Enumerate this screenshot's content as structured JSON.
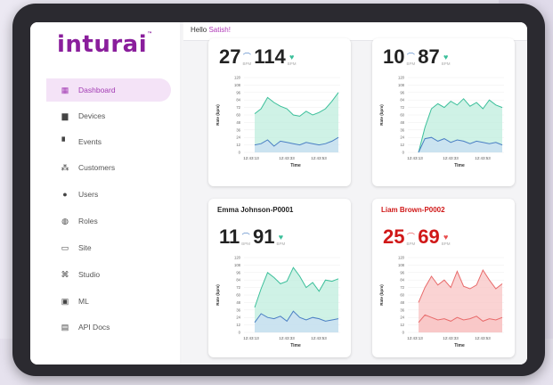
{
  "app": {
    "logo_text": "inturai",
    "greeting_prefix": "Hello",
    "user_name": "Satish!"
  },
  "sidebar": {
    "items": [
      {
        "label": "Dashboard",
        "icon": "grid-icon",
        "active": true
      },
      {
        "label": "Devices",
        "icon": "devices-icon",
        "active": false
      },
      {
        "label": "Events",
        "icon": "events-icon",
        "active": false
      },
      {
        "label": "Customers",
        "icon": "customers-icon",
        "active": false
      },
      {
        "label": "Users",
        "icon": "user-icon",
        "active": false
      },
      {
        "label": "Roles",
        "icon": "roles-icon",
        "active": false
      },
      {
        "label": "Site",
        "icon": "site-icon",
        "active": false
      },
      {
        "label": "Studio",
        "icon": "studio-icon",
        "active": false
      },
      {
        "label": "ML",
        "icon": "ml-icon",
        "active": false
      },
      {
        "label": "API Docs",
        "icon": "docs-icon",
        "active": false
      }
    ]
  },
  "colors": {
    "brand": "#8a1e9c",
    "active_bg": "#f4e3f7",
    "heart_fill": "#bfeedd",
    "heart_line": "#3bbf9a",
    "resp_fill": "#c9def3",
    "resp_line": "#4a7fc4",
    "alert_fill": "#f8c4c4",
    "alert_line": "#e86a6a"
  },
  "cards": [
    {
      "title": "",
      "alert": false,
      "resp_rate": "27",
      "heart_rate": "114",
      "unit": "BPM",
      "ylabel": "Rate (bpm)",
      "xlabel": "Time",
      "y_ticks": [
        "120",
        "108",
        "96",
        "84",
        "72",
        "60",
        "48",
        "36",
        "24",
        "12",
        "0"
      ],
      "x_ticks": [
        "12:43:13",
        "12:43:33",
        "12:43:53"
      ],
      "heart_series": [
        62,
        70,
        88,
        80,
        74,
        70,
        60,
        58,
        66,
        60,
        64,
        70,
        82,
        96
      ],
      "resp_series": [
        12,
        14,
        20,
        10,
        18,
        16,
        14,
        12,
        16,
        14,
        12,
        14,
        18,
        24
      ]
    },
    {
      "title": "",
      "alert": false,
      "resp_rate": "10",
      "heart_rate": "87",
      "unit": "BPM",
      "ylabel": "Rate (bpm)",
      "xlabel": "Time",
      "y_ticks": [
        "120",
        "108",
        "96",
        "84",
        "72",
        "60",
        "48",
        "36",
        "24",
        "12",
        "0"
      ],
      "x_ticks": [
        "12:43:13",
        "12:43:33",
        "12:43:53"
      ],
      "heart_series": [
        0,
        40,
        70,
        78,
        72,
        82,
        76,
        86,
        74,
        80,
        70,
        84,
        76,
        72
      ],
      "resp_series": [
        0,
        22,
        24,
        18,
        22,
        16,
        20,
        18,
        14,
        18,
        16,
        14,
        16,
        12
      ]
    },
    {
      "title": "Emma Johnson-P0001",
      "alert": false,
      "resp_rate": "11",
      "heart_rate": "91",
      "unit": "BPM",
      "ylabel": "Rate (bpm)",
      "xlabel": "Time",
      "y_ticks": [
        "120",
        "108",
        "96",
        "84",
        "72",
        "60",
        "48",
        "36",
        "24",
        "12",
        "0"
      ],
      "x_ticks": [
        "12:43:13",
        "12:43:33",
        "12:43:53"
      ],
      "heart_series": [
        40,
        70,
        96,
        88,
        78,
        82,
        104,
        90,
        72,
        80,
        66,
        84,
        82,
        86
      ],
      "resp_series": [
        16,
        30,
        24,
        22,
        26,
        18,
        34,
        24,
        20,
        24,
        22,
        18,
        20,
        22
      ]
    },
    {
      "title": "Liam Brown-P0002",
      "alert": true,
      "resp_rate": "25",
      "heart_rate": "69",
      "unit": "BPM",
      "ylabel": "Rate (bpm)",
      "xlabel": "Time",
      "y_ticks": [
        "120",
        "108",
        "96",
        "84",
        "72",
        "60",
        "48",
        "36",
        "24",
        "12",
        "0"
      ],
      "x_ticks": [
        "12:43:13",
        "12:43:33",
        "12:43:53"
      ],
      "heart_series": [
        48,
        72,
        90,
        76,
        84,
        72,
        98,
        74,
        70,
        76,
        100,
        84,
        70,
        78
      ],
      "resp_series": [
        16,
        28,
        24,
        20,
        22,
        18,
        24,
        20,
        22,
        26,
        18,
        22,
        20,
        24
      ]
    }
  ]
}
